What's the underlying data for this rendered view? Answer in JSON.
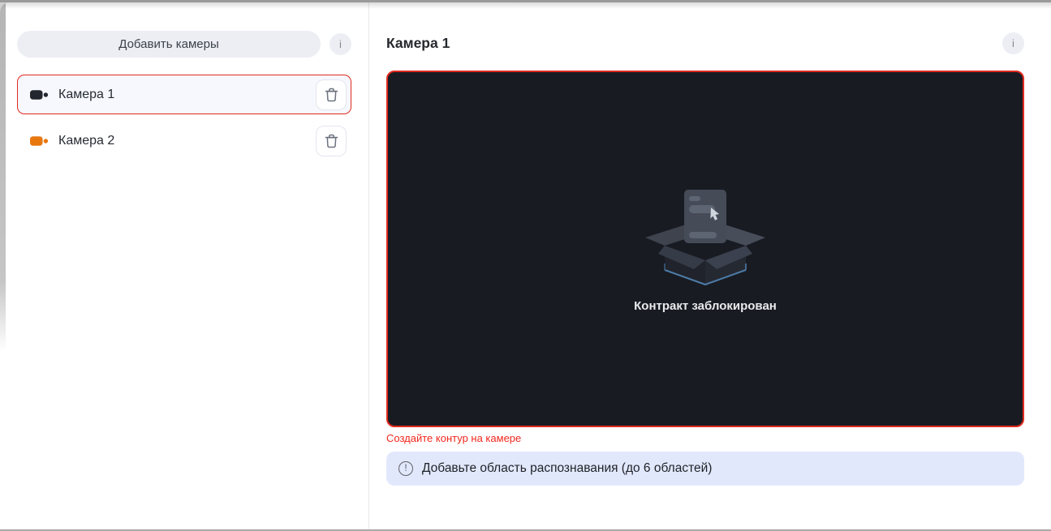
{
  "colors": {
    "accent_red": "#e02a1f",
    "selected_bg": "#f6f8fe",
    "banner_bg": "#e2e8fc",
    "surface_muted": "#eceef4",
    "preview_bg": "#181b22",
    "error_text": "#f2271c"
  },
  "sidebar": {
    "add_button_label": "Добавить камеры",
    "info_icon_char": "i",
    "cameras": [
      {
        "label": "Камера 1",
        "icon_color": "#23262e",
        "selected": true
      },
      {
        "label": "Камера 2",
        "icon_color": "#e8770e",
        "selected": false
      }
    ]
  },
  "main": {
    "title": "Камера 1",
    "info_icon_char": "i",
    "preview": {
      "placeholder_text": "Контракт заблокирован"
    },
    "error_text": "Создайте контур на камере",
    "notice": {
      "icon_char": "!",
      "text": "Добавьте область распознавания (до 6 областей)"
    }
  }
}
